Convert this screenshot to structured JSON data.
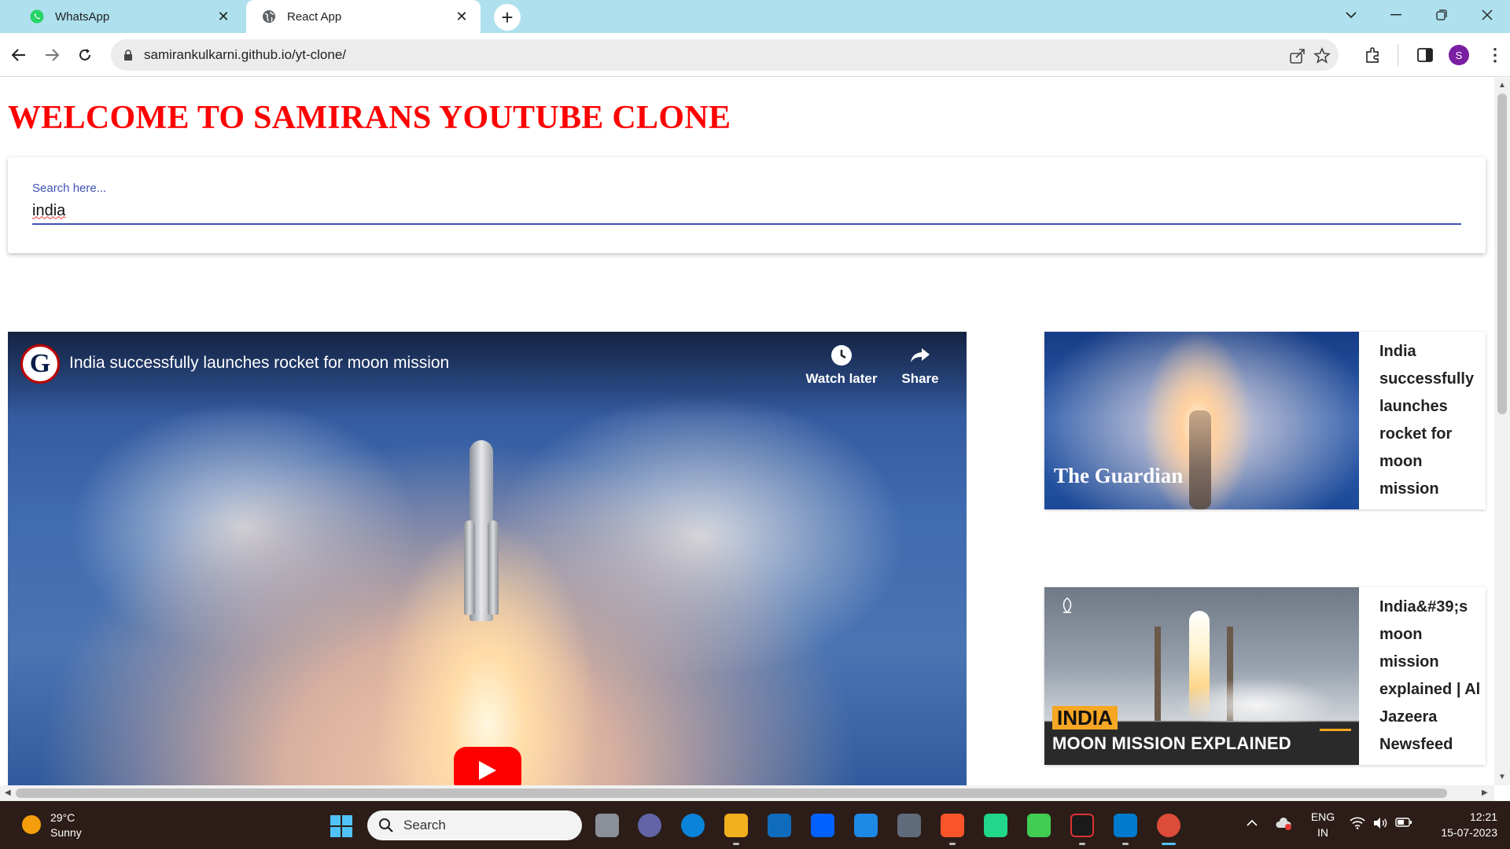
{
  "browser": {
    "tabs": [
      {
        "title": "WhatsApp",
        "active": false
      },
      {
        "title": "React App",
        "active": true
      }
    ],
    "new_tab_label": "+",
    "url": "samirankulkarni.github.io/yt-clone/",
    "profile_initial": "S"
  },
  "page": {
    "heading": "WELCOME TO SAMIRANS YOUTUBE CLONE",
    "search": {
      "label": "Search here...",
      "value": "india"
    },
    "main_video": {
      "title": "India successfully launches rocket for moon mission",
      "channel_logo_text": "G",
      "watch_later_label": "Watch later",
      "share_label": "Share"
    },
    "related_videos": [
      {
        "title": "India successfully launches rocket for moon mission",
        "thumbnail_overlay": "The Guardian"
      },
      {
        "title": "India&#39;s moon mission explained | Al Jazeera Newsfeed",
        "thumbnail_tag": "INDIA",
        "thumbnail_caption": "MOON MISSION EXPLAINED"
      }
    ]
  },
  "taskbar": {
    "weather_temp": "29°C",
    "weather_desc": "Sunny",
    "search_placeholder": "Search",
    "language_line1": "ENG",
    "language_line2": "IN",
    "time": "12:21",
    "date": "15-07-2023"
  },
  "colors": {
    "heading": "#ff0000",
    "search_accent": "#3f51b5",
    "tab_strip": "#aee0ee",
    "taskbar": "#2c1d18",
    "play_button": "#ff0000"
  }
}
